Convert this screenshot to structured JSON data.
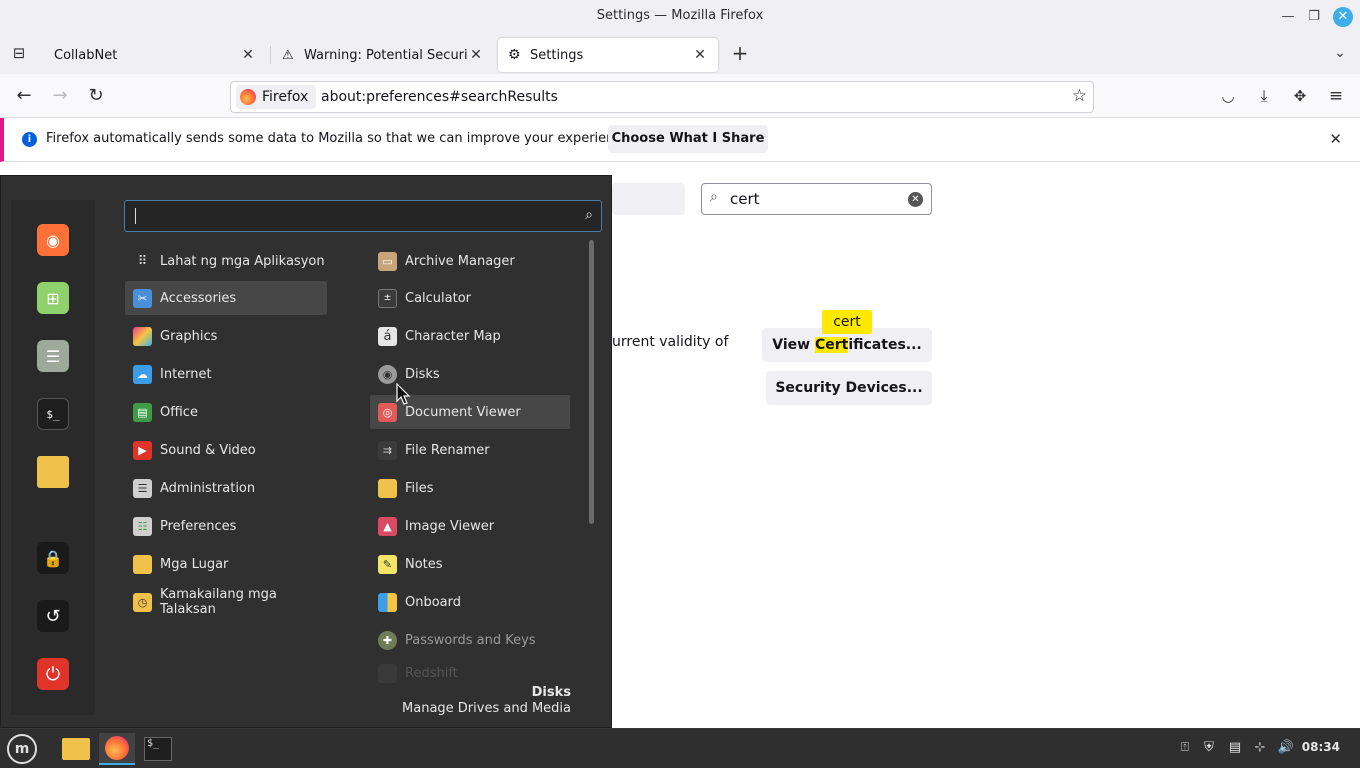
{
  "window": {
    "title": "Settings — Mozilla Firefox"
  },
  "tabs": [
    {
      "label": "CollabNet"
    },
    {
      "label": "Warning: Potential Security Risk Ahead"
    },
    {
      "label": "Settings"
    }
  ],
  "navbar": {
    "identity_label": "Firefox",
    "url": "about:preferences#searchResults"
  },
  "notification": {
    "message": "Firefox automatically sends some data to Mozilla so that we can improve your experience.",
    "button": "Choose What I Share"
  },
  "prefs": {
    "search_value": "cert",
    "validity_fragment": "urrent validity of",
    "view_cert_before": "View ",
    "view_cert_hl": "Cert",
    "view_cert_after": "ificates...",
    "security_devices": "Security Devices...",
    "tooltip": "cert"
  },
  "menu": {
    "categories": [
      {
        "label": "Lahat ng mga Aplikasyon",
        "icon": "grid-icon"
      },
      {
        "label": "Accessories",
        "icon": "accessories-icon",
        "selected": true
      },
      {
        "label": "Graphics",
        "icon": "graphics-icon"
      },
      {
        "label": "Internet",
        "icon": "internet-icon"
      },
      {
        "label": "Office",
        "icon": "office-icon"
      },
      {
        "label": "Sound & Video",
        "icon": "sound-video-icon"
      },
      {
        "label": "Administration",
        "icon": "administration-icon"
      },
      {
        "label": "Preferences",
        "icon": "preferences-icon"
      },
      {
        "label": "Mga Lugar",
        "icon": "folder-icon"
      },
      {
        "label": "Kamakailang mga Talaksan",
        "icon": "recent-files-icon"
      }
    ],
    "apps": [
      {
        "label": "Archive Manager",
        "icon": "archive-icon"
      },
      {
        "label": "Calculator",
        "icon": "calculator-icon"
      },
      {
        "label": "Character Map",
        "icon": "character-map-icon"
      },
      {
        "label": "Disks",
        "icon": "disks-icon"
      },
      {
        "label": "Document Viewer",
        "icon": "document-viewer-icon",
        "selected": true
      },
      {
        "label": "File Renamer",
        "icon": "file-renamer-icon"
      },
      {
        "label": "Files",
        "icon": "files-icon"
      },
      {
        "label": "Image Viewer",
        "icon": "image-viewer-icon"
      },
      {
        "label": "Notes",
        "icon": "notes-icon"
      },
      {
        "label": "Onboard",
        "icon": "onboard-icon"
      },
      {
        "label": "Passwords and Keys",
        "icon": "passwords-keys-icon",
        "dim": true
      },
      {
        "label": "Redshift",
        "icon": "redshift-icon",
        "faint": true
      }
    ],
    "description_title": "Disks",
    "description_text": "Manage Drives and Media"
  },
  "taskbar": {
    "clock": "08:34"
  },
  "colors": {
    "accent": "#3daee9",
    "highlight": "#ffe900",
    "notification_stripe": "#e31587"
  }
}
